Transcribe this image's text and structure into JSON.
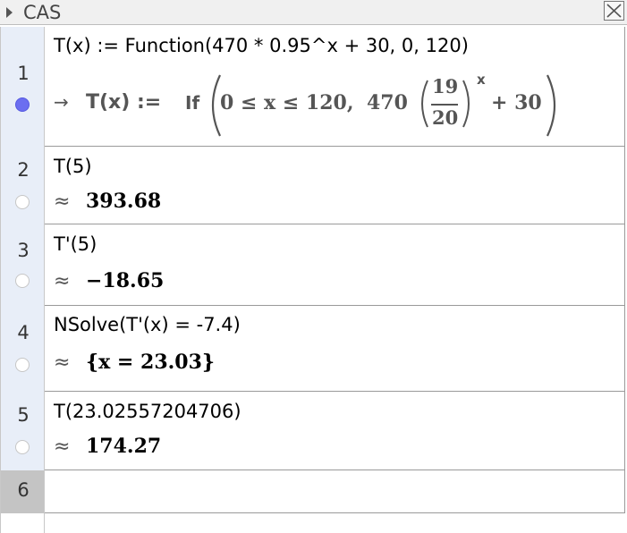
{
  "window": {
    "title": "CAS"
  },
  "rows": [
    {
      "number": "1",
      "input": "T(x) := Function(470 * 0.95^x + 30, 0, 120)",
      "output": {
        "arrow": "→",
        "lhs": "T(x) :=",
        "if": "If",
        "condition": "0 ≤ x ≤ 120,",
        "coef": "470",
        "num": "19",
        "den": "20",
        "exp": "x",
        "tail": "+ 30"
      },
      "marble_active": true
    },
    {
      "number": "2",
      "input": "T(5)",
      "approx": "≈",
      "result": "393.68",
      "marble_active": false
    },
    {
      "number": "3",
      "input": "T'(5)",
      "approx": "≈",
      "result": "−18.65",
      "marble_active": false
    },
    {
      "number": "4",
      "input": "NSolve(T'(x) = -7.4)",
      "approx": "≈",
      "result": "{x = 23.03}",
      "marble_active": false
    },
    {
      "number": "5",
      "input": "T(23.02557204706)",
      "approx": "≈",
      "result": "174.27",
      "marble_active": false
    },
    {
      "number": "6",
      "input": "",
      "marble_active": false
    }
  ],
  "icons": {
    "collapse": "triangle-right-icon",
    "close": "close-icon"
  },
  "colors": {
    "row_header_bg": "#e8eef8",
    "active_marble": "#6b6ef0",
    "empty_row_header": "#c4c4c4"
  }
}
